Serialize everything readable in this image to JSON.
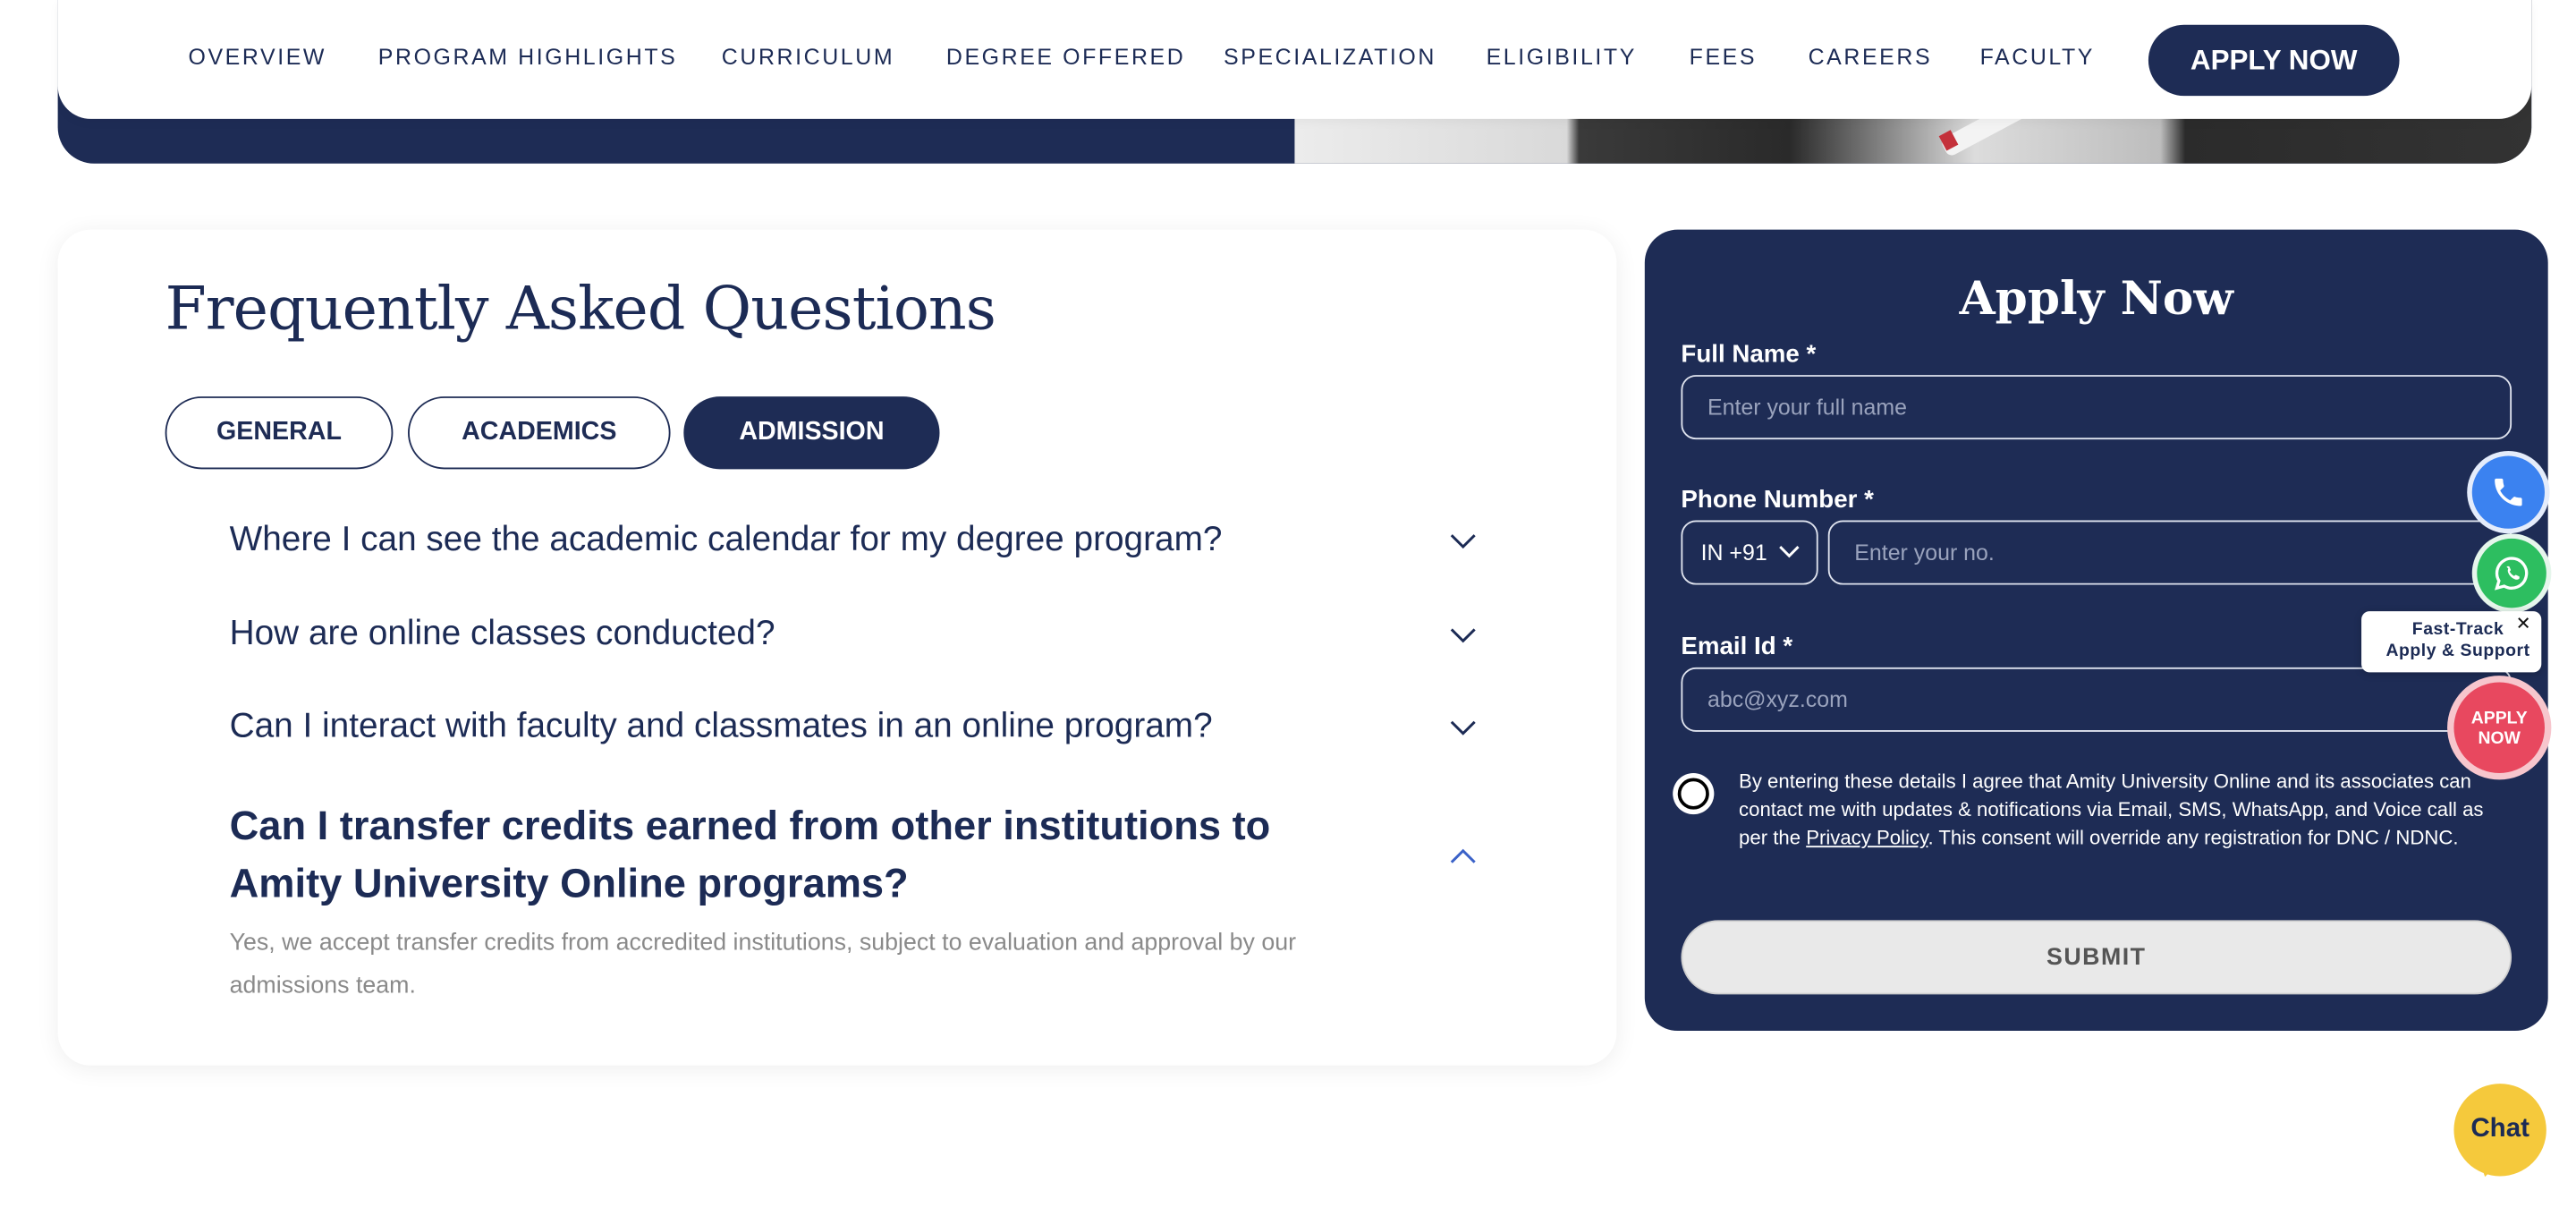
{
  "nav": {
    "items": [
      "OVERVIEW",
      "PROGRAM HIGHLIGHTS",
      "CURRICULUM",
      "DEGREE OFFERED",
      "SPECIALIZATION",
      "ELIGIBILITY",
      "FEES",
      "CAREERS",
      "FACULTY"
    ],
    "apply_label": "APPLY NOW"
  },
  "faq": {
    "title": "Frequently Asked Questions",
    "tabs": [
      {
        "label": "GENERAL",
        "active": false
      },
      {
        "label": "ACADEMICS",
        "active": false
      },
      {
        "label": "ADMISSION",
        "active": true
      }
    ],
    "questions": [
      {
        "text": "Where I can see the academic calendar for my degree program?",
        "expanded": false
      },
      {
        "text": "How are online classes conducted?",
        "expanded": false
      },
      {
        "text": "Can I interact with faculty and classmates in an online program?",
        "expanded": false
      },
      {
        "text": "Can I transfer credits earned from other institutions to Amity University Online programs?",
        "expanded": true
      }
    ],
    "answer": "Yes, we accept transfer credits from accredited institutions, subject to evaluation and approval by our admissions team."
  },
  "form": {
    "title": "Apply Now",
    "full_name_label": "Full Name *",
    "full_name_placeholder": "Enter your full name",
    "phone_label": "Phone Number *",
    "country_code": "IN +91",
    "phone_placeholder": "Enter your no.",
    "email_label": "Email Id *",
    "email_placeholder": "abc@xyz.com",
    "consent_before": "By entering these details I agree that Amity University Online and its associates can contact me with updates & notifications via Email, SMS, WhatsApp, and Voice call as per the ",
    "consent_link": "Privacy Policy",
    "consent_after": ". This consent will override any registration for DNC / NDNC.",
    "submit_label": "SUBMIT"
  },
  "widgets": {
    "fast_track_line1": "Fast-Track",
    "fast_track_line2": "Apply & Support",
    "close_glyph": "✕",
    "apply_line1": "APPLY",
    "apply_line2": "NOW",
    "chat_label": "Chat"
  },
  "colors": {
    "navy": "#1e2c55",
    "phone_blue": "#3b82f0",
    "whatsapp_green": "#2dbe60",
    "apply_red": "#e8485f",
    "chat_yellow": "#f5c93c"
  }
}
